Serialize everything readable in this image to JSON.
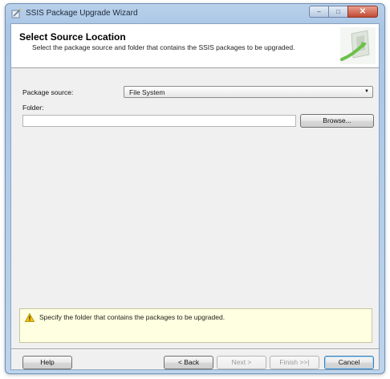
{
  "window": {
    "title": "SSIS Package Upgrade Wizard",
    "minimize_glyph": "–",
    "maximize_glyph": "□",
    "close_glyph": "✕"
  },
  "header": {
    "title": "Select Source Location",
    "subtitle": "Select the package source and folder that contains the SSIS packages to be upgraded."
  },
  "form": {
    "package_source_label": "Package source:",
    "package_source_value": "File System",
    "dropdown_arrow": "▼",
    "folder_label": "Folder:",
    "folder_value": "",
    "browse_label": "Browse..."
  },
  "message": {
    "text": "Specify the folder that contains the packages to be upgraded."
  },
  "footer": {
    "help": "Help",
    "back": "< Back",
    "next": "Next >",
    "finish": "Finish >>|",
    "cancel": "Cancel"
  },
  "colors": {
    "accent": "#3c7fb1",
    "message_bg": "#ffffe1",
    "warning": "#f5c400"
  }
}
